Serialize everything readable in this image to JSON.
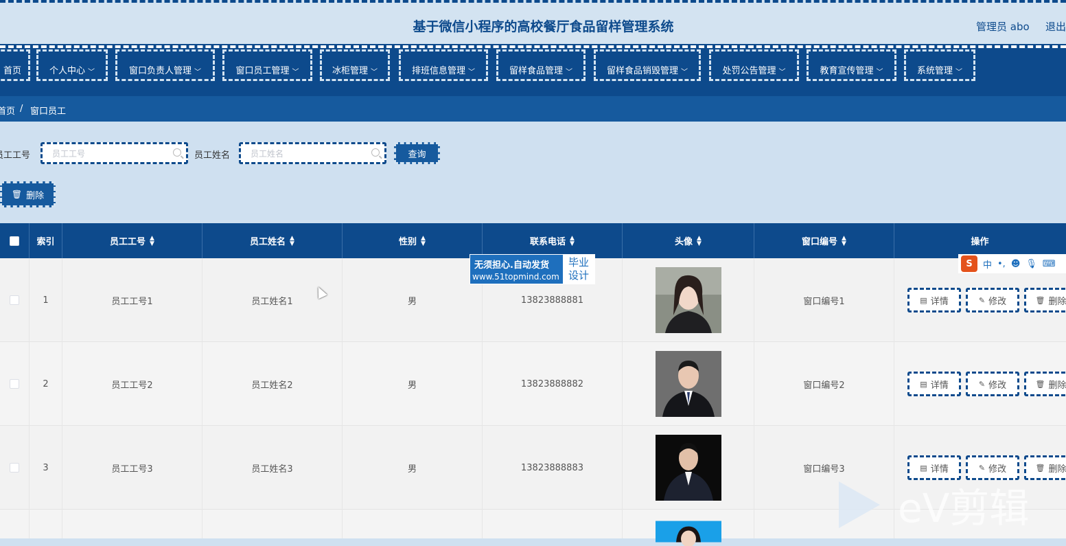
{
  "header": {
    "title": "基于微信小程序的高校餐厅食品留样管理系统",
    "user": "管理员 abo",
    "logout": "退出"
  },
  "nav": [
    {
      "label": "首页",
      "chevron": false
    },
    {
      "label": "个人中心",
      "chevron": true
    },
    {
      "label": "窗口负责人管理",
      "chevron": true
    },
    {
      "label": "窗口员工管理",
      "chevron": true
    },
    {
      "label": "冰柜管理",
      "chevron": true
    },
    {
      "label": "排班信息管理",
      "chevron": true
    },
    {
      "label": "留样食品管理",
      "chevron": true
    },
    {
      "label": "留样食品销毁管理",
      "chevron": true
    },
    {
      "label": "处罚公告管理",
      "chevron": true
    },
    {
      "label": "教育宣传管理",
      "chevron": true
    },
    {
      "label": "系统管理",
      "chevron": true
    }
  ],
  "breadcrumb": {
    "home": "首页",
    "sep": "/",
    "current": "窗口员工"
  },
  "search": {
    "id_label": "员工工号",
    "id_placeholder": "员工工号",
    "name_label": "员工姓名",
    "name_placeholder": "员工姓名",
    "query_label": "查询"
  },
  "toolbar": {
    "delete_label": "删除"
  },
  "table": {
    "headers": [
      "索引",
      "员工工号",
      "员工姓名",
      "性别",
      "联系电话",
      "头像",
      "窗口编号",
      "操作"
    ],
    "rows": [
      {
        "index": "1",
        "id": "员工工号1",
        "name": "员工姓名1",
        "gender": "男",
        "phone": "13823888881",
        "window": "窗口编号1"
      },
      {
        "index": "2",
        "id": "员工工号2",
        "name": "员工姓名2",
        "gender": "男",
        "phone": "13823888882",
        "window": "窗口编号2"
      },
      {
        "index": "3",
        "id": "员工工号3",
        "name": "员工姓名3",
        "gender": "男",
        "phone": "13823888883",
        "window": "窗口编号3"
      }
    ],
    "actions": {
      "detail": "详情",
      "edit": "修改",
      "delete": "删除"
    }
  },
  "overlays": {
    "watermark_line1": "无须担心.自动发货",
    "watermark_line2": "www.51topmind.com",
    "watermark_badge1": "毕业",
    "watermark_badge2": "设计",
    "ime_mode": "中",
    "ime_punct": "•,",
    "editor_brand": "eV剪辑"
  },
  "colors": {
    "primary": "#0d4a8c",
    "secondary": "#165a9e",
    "background": "#cfe0f0"
  }
}
